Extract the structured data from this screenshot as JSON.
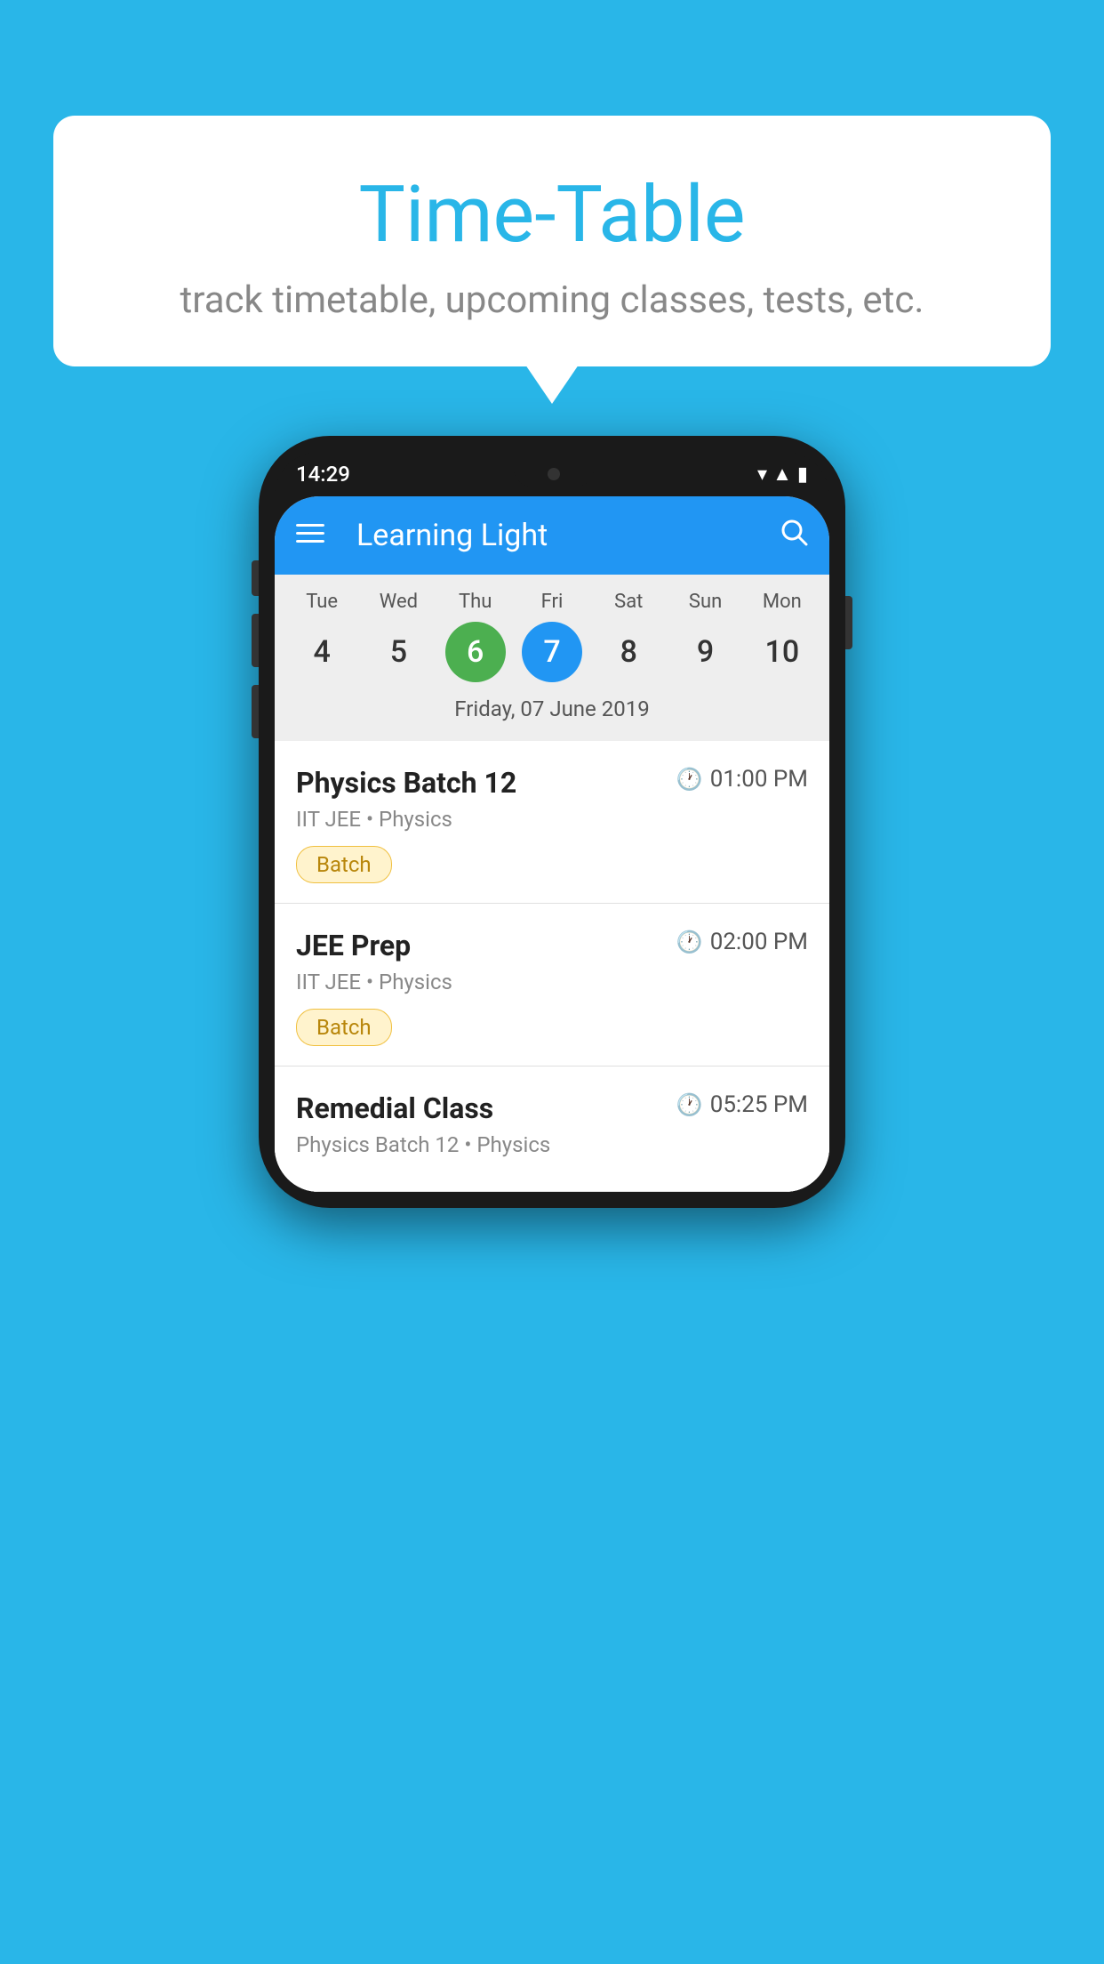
{
  "background_color": "#29B6E8",
  "bubble": {
    "title": "Time-Table",
    "subtitle": "track timetable, upcoming classes, tests, etc."
  },
  "phone": {
    "status_bar": {
      "time": "14:29"
    },
    "toolbar": {
      "title": "Learning Light"
    },
    "calendar": {
      "days": [
        "Tue",
        "Wed",
        "Thu",
        "Fri",
        "Sat",
        "Sun",
        "Mon"
      ],
      "dates": [
        "4",
        "5",
        "6",
        "7",
        "8",
        "9",
        "10"
      ],
      "today_index": 2,
      "selected_index": 3,
      "selected_label": "Friday, 07 June 2019"
    },
    "schedule": [
      {
        "title": "Physics Batch 12",
        "time": "01:00 PM",
        "subtitle": "IIT JEE • Physics",
        "tag": "Batch"
      },
      {
        "title": "JEE Prep",
        "time": "02:00 PM",
        "subtitle": "IIT JEE • Physics",
        "tag": "Batch"
      },
      {
        "title": "Remedial Class",
        "time": "05:25 PM",
        "subtitle": "Physics Batch 12 • Physics",
        "tag": ""
      }
    ]
  }
}
